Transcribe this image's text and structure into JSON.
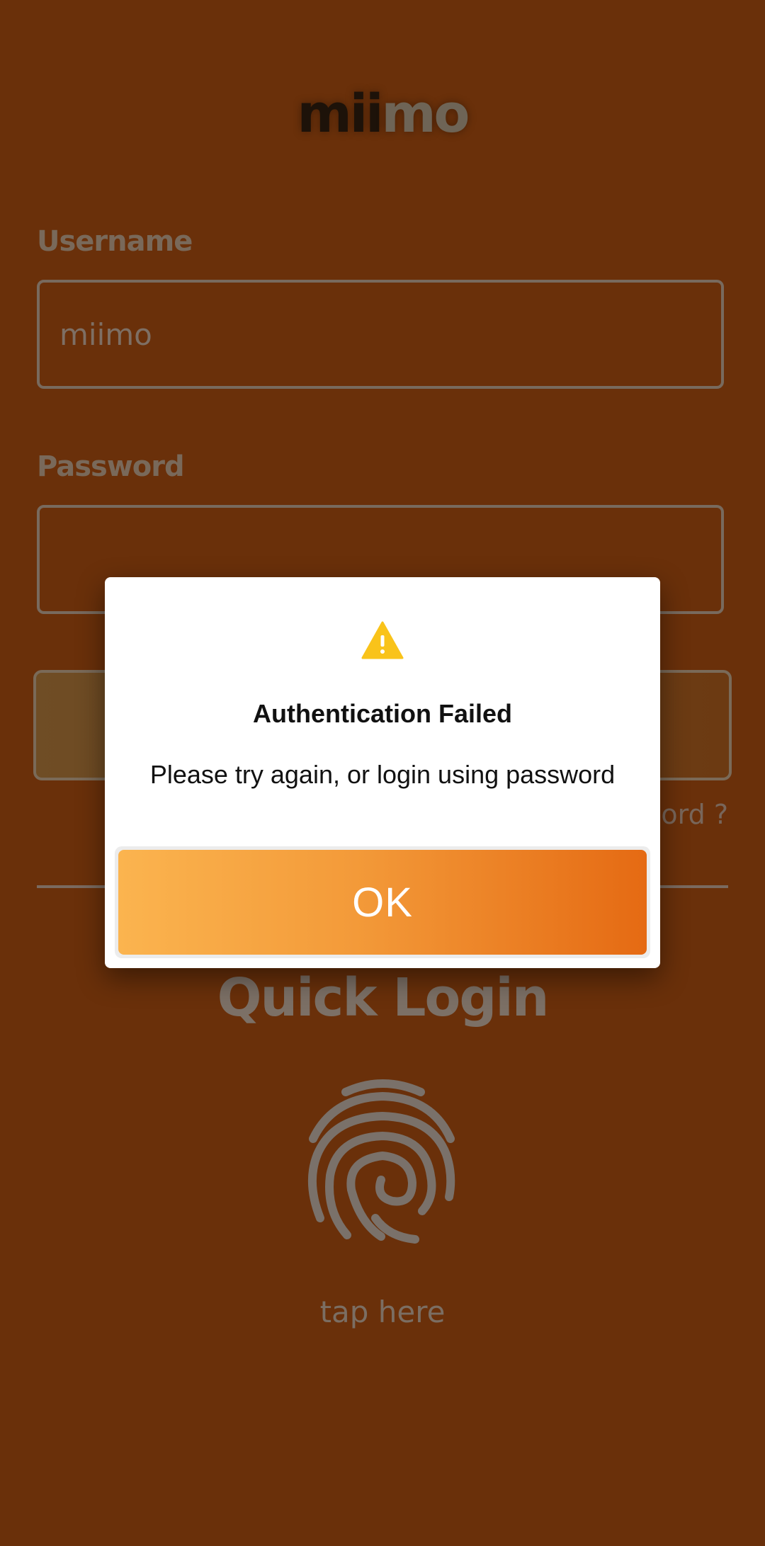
{
  "app": {
    "logo_part1": "mii",
    "logo_part2": "mo"
  },
  "form": {
    "username_label": "Username",
    "username_value": "miimo",
    "password_label": "Password",
    "password_value": "",
    "forgot_partial_text": "word ?"
  },
  "quick_login": {
    "title": "Quick Login",
    "tap_text": "tap here",
    "icon": "fingerprint-icon"
  },
  "dialog": {
    "icon": "warning-icon",
    "title": "Authentication Failed",
    "message": "Please try again, or login using password",
    "ok_label": "OK"
  },
  "colors": {
    "background": "#6a300a",
    "dialog_bg": "#ffffff",
    "warning": "#f9c31a",
    "ok_gradient_start": "#fbb44f",
    "ok_gradient_end": "#e56a13"
  }
}
